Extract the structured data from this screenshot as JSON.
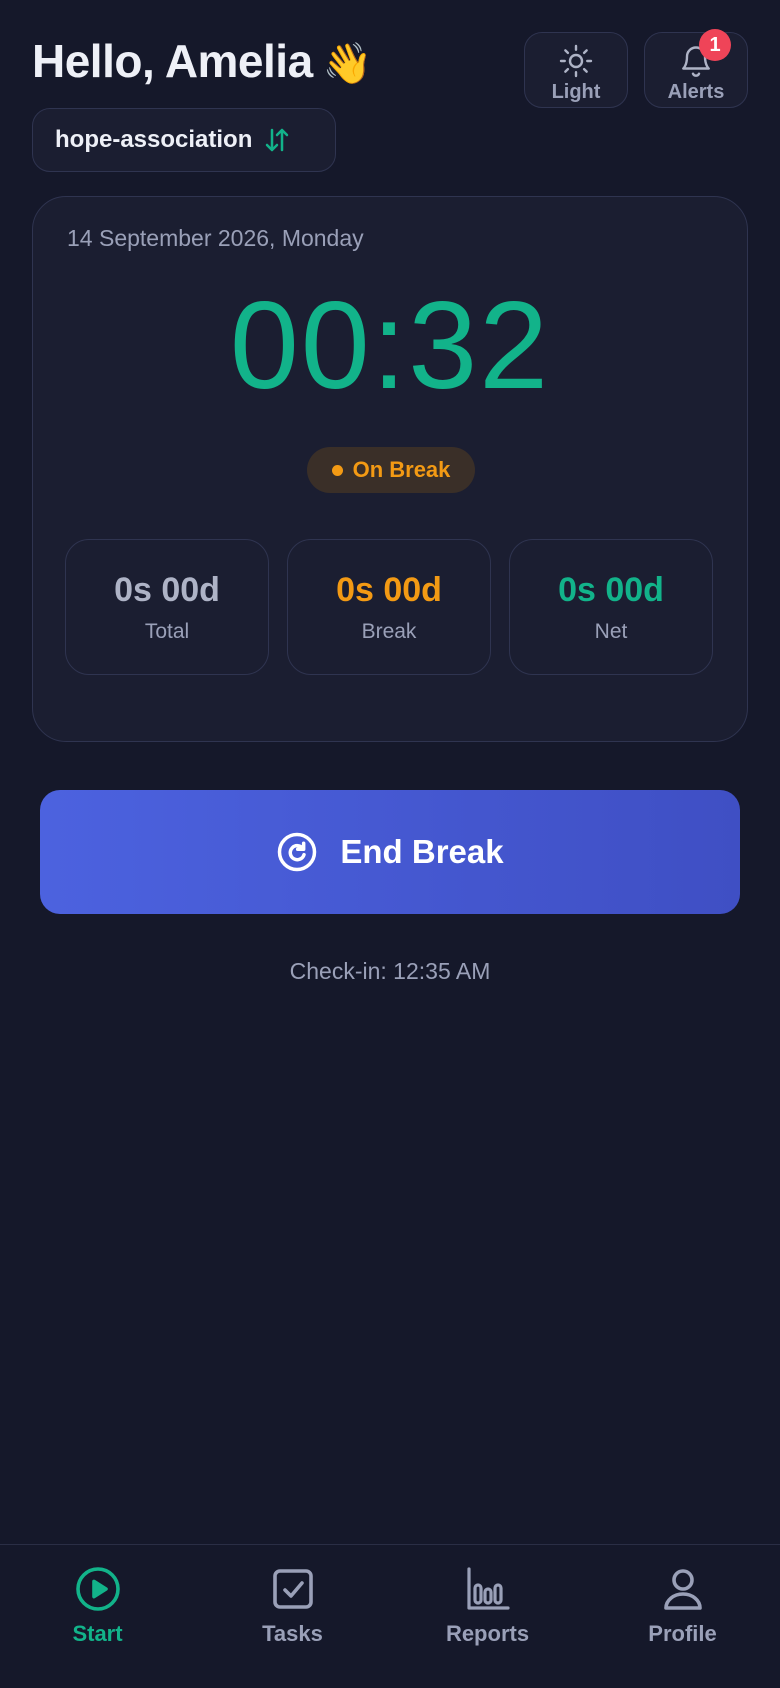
{
  "header": {
    "greeting": "Hello, Amelia",
    "greeting_emoji": "👋",
    "theme_button_label": "Light",
    "alerts_button_label": "Alerts",
    "alerts_count": "1"
  },
  "org_switcher": {
    "name": "hope-association",
    "icon": "swap-vertical-icon"
  },
  "card": {
    "date": "14 September 2026, Monday",
    "timer": "00:32",
    "status": "On Break",
    "stats": [
      {
        "value": "0s 00d",
        "label": "Total"
      },
      {
        "value": "0s 00d",
        "label": "Break"
      },
      {
        "value": "0s 00d",
        "label": "Net"
      }
    ]
  },
  "action": {
    "label": "End Break",
    "icon": "refresh-icon"
  },
  "checkin": "Check-in: 12:35 AM",
  "nav": [
    {
      "label": "Start",
      "icon": "play-circle-icon",
      "active": true
    },
    {
      "label": "Tasks",
      "icon": "checkbox-icon",
      "active": false
    },
    {
      "label": "Reports",
      "icon": "bar-chart-icon",
      "active": false
    },
    {
      "label": "Profile",
      "icon": "user-icon",
      "active": false
    }
  ],
  "colors": {
    "background": "#15182a",
    "accent_green": "#12b38a",
    "accent_orange": "#f39a14",
    "button_blue": "#4c62df",
    "badge_red": "#ef4458"
  }
}
